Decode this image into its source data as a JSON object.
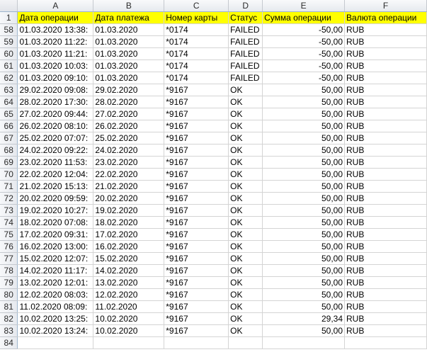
{
  "columns": [
    "A",
    "B",
    "C",
    "D",
    "E",
    "F"
  ],
  "header_row": {
    "num": "1",
    "cells": [
      "Дата операции",
      "Дата платежа",
      "Номер карты",
      "Статус",
      "Сумма операции",
      "Валюта операции"
    ]
  },
  "rows": [
    {
      "num": "58",
      "cells": [
        "01.03.2020 13:38:",
        "01.03.2020",
        "*0174",
        "FAILED",
        "-50,00",
        "RUB"
      ]
    },
    {
      "num": "59",
      "cells": [
        "01.03.2020 11:22:",
        "01.03.2020",
        "*0174",
        "FAILED",
        "-50,00",
        "RUB"
      ]
    },
    {
      "num": "60",
      "cells": [
        "01.03.2020 11:21:",
        "01.03.2020",
        "*0174",
        "FAILED",
        "-50,00",
        "RUB"
      ]
    },
    {
      "num": "61",
      "cells": [
        "01.03.2020 10:03:",
        "01.03.2020",
        "*0174",
        "FAILED",
        "-50,00",
        "RUB"
      ]
    },
    {
      "num": "62",
      "cells": [
        "01.03.2020 09:10:",
        "01.03.2020",
        "*0174",
        "FAILED",
        "-50,00",
        "RUB"
      ]
    },
    {
      "num": "63",
      "cells": [
        "29.02.2020 09:08:",
        "29.02.2020",
        "*9167",
        "OK",
        "50,00",
        "RUB"
      ]
    },
    {
      "num": "64",
      "cells": [
        "28.02.2020 17:30:",
        "28.02.2020",
        "*9167",
        "OK",
        "50,00",
        "RUB"
      ]
    },
    {
      "num": "65",
      "cells": [
        "27.02.2020 09:44:",
        "27.02.2020",
        "*9167",
        "OK",
        "50,00",
        "RUB"
      ]
    },
    {
      "num": "66",
      "cells": [
        "26.02.2020 08:10:",
        "26.02.2020",
        "*9167",
        "OK",
        "50,00",
        "RUB"
      ]
    },
    {
      "num": "67",
      "cells": [
        "25.02.2020 07:07:",
        "25.02.2020",
        "*9167",
        "OK",
        "50,00",
        "RUB"
      ]
    },
    {
      "num": "68",
      "cells": [
        "24.02.2020 09:22:",
        "24.02.2020",
        "*9167",
        "OK",
        "50,00",
        "RUB"
      ]
    },
    {
      "num": "69",
      "cells": [
        "23.02.2020 11:53:",
        "23.02.2020",
        "*9167",
        "OK",
        "50,00",
        "RUB"
      ]
    },
    {
      "num": "70",
      "cells": [
        "22.02.2020 12:04:",
        "22.02.2020",
        "*9167",
        "OK",
        "50,00",
        "RUB"
      ]
    },
    {
      "num": "71",
      "cells": [
        "21.02.2020 15:13:",
        "21.02.2020",
        "*9167",
        "OK",
        "50,00",
        "RUB"
      ]
    },
    {
      "num": "72",
      "cells": [
        "20.02.2020 09:59:",
        "20.02.2020",
        "*9167",
        "OK",
        "50,00",
        "RUB"
      ]
    },
    {
      "num": "73",
      "cells": [
        "19.02.2020 10:27:",
        "19.02.2020",
        "*9167",
        "OK",
        "50,00",
        "RUB"
      ]
    },
    {
      "num": "74",
      "cells": [
        "18.02.2020 07:08:",
        "18.02.2020",
        "*9167",
        "OK",
        "50,00",
        "RUB"
      ]
    },
    {
      "num": "75",
      "cells": [
        "17.02.2020 09:31:",
        "17.02.2020",
        "*9167",
        "OK",
        "50,00",
        "RUB"
      ]
    },
    {
      "num": "76",
      "cells": [
        "16.02.2020 13:00:",
        "16.02.2020",
        "*9167",
        "OK",
        "50,00",
        "RUB"
      ]
    },
    {
      "num": "77",
      "cells": [
        "15.02.2020 12:07:",
        "15.02.2020",
        "*9167",
        "OK",
        "50,00",
        "RUB"
      ]
    },
    {
      "num": "78",
      "cells": [
        "14.02.2020 11:17:",
        "14.02.2020",
        "*9167",
        "OK",
        "50,00",
        "RUB"
      ]
    },
    {
      "num": "79",
      "cells": [
        "13.02.2020 12:01:",
        "13.02.2020",
        "*9167",
        "OK",
        "50,00",
        "RUB"
      ]
    },
    {
      "num": "80",
      "cells": [
        "12.02.2020 08:03:",
        "12.02.2020",
        "*9167",
        "OK",
        "50,00",
        "RUB"
      ]
    },
    {
      "num": "81",
      "cells": [
        "11.02.2020 08:09:",
        "11.02.2020",
        "*9167",
        "OK",
        "50,00",
        "RUB"
      ]
    },
    {
      "num": "82",
      "cells": [
        "10.02.2020 13:25:",
        "10.02.2020",
        "*9167",
        "OK",
        "29,34",
        "RUB"
      ]
    },
    {
      "num": "83",
      "cells": [
        "10.02.2020 13:24:",
        "10.02.2020",
        "*9167",
        "OK",
        "50,00",
        "RUB"
      ]
    },
    {
      "num": "84",
      "cells": [
        "",
        "",
        "",
        "",
        "",
        ""
      ]
    }
  ],
  "colors": {
    "header_highlight": "#ffff00",
    "gridline": "#d4d4d4",
    "heading_border": "#9eb6ce"
  }
}
